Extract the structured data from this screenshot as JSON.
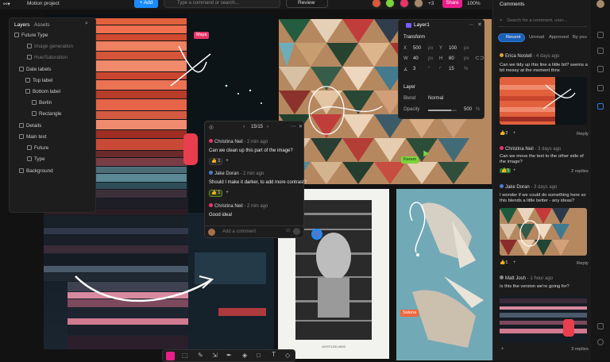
{
  "topbar": {
    "project_title": "Motion project",
    "add_label": "Add",
    "command_placeholder": "Type a command or search...",
    "review_label": "Review",
    "extra_count": "+3",
    "share_label": "Share",
    "zoom": "100%"
  },
  "layers_panel": {
    "tab_layers": "Layers",
    "tab_assets": "Assets",
    "items": [
      {
        "label": "Future Type"
      },
      {
        "label": "Image generation"
      },
      {
        "label": "Hue/Saturation"
      },
      {
        "label": "Date labels"
      },
      {
        "label": "Top label"
      },
      {
        "label": "Bottom label"
      },
      {
        "label": "Berlin"
      },
      {
        "label": "Rectangle"
      },
      {
        "label": "Details"
      },
      {
        "label": "Main text"
      },
      {
        "label": "Future"
      },
      {
        "label": "Type"
      },
      {
        "label": "Background"
      }
    ]
  },
  "props_panel": {
    "title": "Layer1",
    "transform_label": "Transform",
    "x_label": "X",
    "x_val": "500",
    "x_unit": "px",
    "y_label": "Y",
    "y_val": "100",
    "y_unit": "px",
    "w_label": "W",
    "w_val": "40",
    "w_unit": "px",
    "h_label": "H",
    "h_val": "80",
    "h_unit": "px",
    "rot_val": "3",
    "rot_unit": "°",
    "corner_val": "15",
    "corner_unit": "%",
    "layer_label": "Layer",
    "blend_label": "Blend",
    "blend_val": "Normal",
    "opacity_label": "Opacity",
    "opacity_val": "500",
    "opacity_unit": "%",
    "opacity_level": 0.8
  },
  "canvas": {
    "tag_maya": "Maya",
    "tag_karam": "Karam",
    "tag_salena": "Salena",
    "poster_caption": "UNTITLED #003"
  },
  "thread": {
    "counter": "15/15",
    "comments": [
      {
        "author": "Christina Neil",
        "time": "2 min ago",
        "text": "Can we clean up this part of the image?",
        "reaction": "👍 1"
      },
      {
        "author": "Jake Doran",
        "time": "2 min ago",
        "text": "Should I make it darker, to add more contrast?",
        "reaction": "👍 1"
      },
      {
        "author": "Christina Neil",
        "time": "2 min ago",
        "text": "Good idea!"
      }
    ],
    "input_placeholder": "Add a comment"
  },
  "sidebar": {
    "title": "Comments",
    "search_placeholder": "Search for a comment, user...",
    "tabs": [
      "Recent",
      "Unread",
      "Approved",
      "By you"
    ],
    "comments": [
      {
        "author": "Erica Nostell",
        "time": "4 days ago",
        "text": "Can we tidy up this line a little bit? seems a bit messy at the moment thnx",
        "reaction": "2",
        "reply": "Reply"
      },
      {
        "author": "Christina Neil",
        "time": "3 days ago",
        "text": "Can we move the text to the other side of the image?",
        "reaction": "1",
        "reply": "2 replies"
      },
      {
        "author": "Jake Doran",
        "time": "3 days ago",
        "text": "I wonder if we could do something here so this blends a little better - any ideas?",
        "reaction": "1",
        "reply": "Reply"
      },
      {
        "author": "Matt Josh",
        "time": "1 hour ago",
        "text": "Is this the version we're going for?",
        "reply": "3 replies"
      }
    ]
  },
  "colors": {
    "accent": "#1a8cff",
    "share": "#e91e8c",
    "karam": "#7bd43a",
    "salena": "#f0673a"
  }
}
